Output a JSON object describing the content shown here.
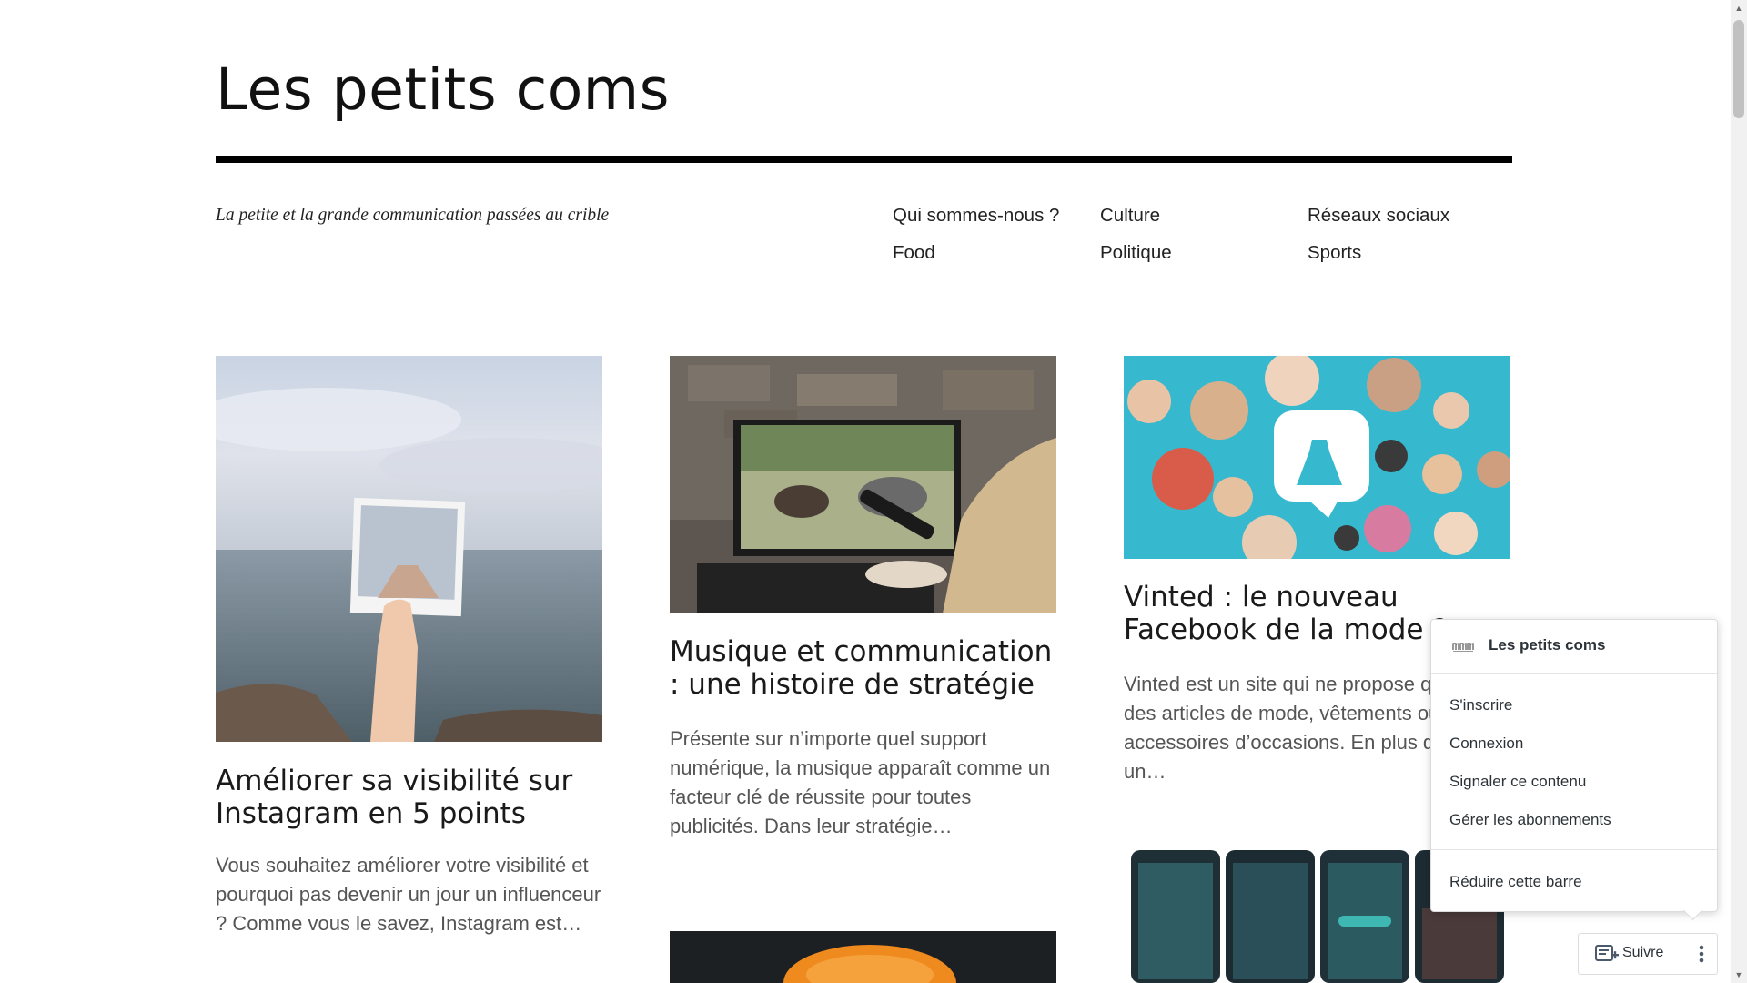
{
  "site": {
    "title": "Les petits coms",
    "tagline": "La petite et la grande communication passées au crible"
  },
  "nav": {
    "items": [
      {
        "label": "Qui sommes-nous ?"
      },
      {
        "label": "Culture"
      },
      {
        "label": "Réseaux sociaux"
      },
      {
        "label": "Food"
      },
      {
        "label": "Politique"
      },
      {
        "label": "Sports"
      }
    ]
  },
  "posts": [
    {
      "title": "Améliorer sa visibilité sur Instagram en 5 points",
      "excerpt": "Vous souhaitez améliorer votre visibilité et pourquoi pas devenir un jour un influenceur ? Comme vous le savez, Instagram est…"
    },
    {
      "title": "Musique et communication : une histoire de stratégie",
      "excerpt": "Présente sur n’importe quel support  numérique, la musique apparaît comme un facteur clé de réussite pour toutes publicités. Dans leur stratégie…"
    },
    {
      "title": "Vinted : le nouveau Facebook de la mode ?",
      "excerpt": "Vinted est un site qui ne propose que des articles de mode, vêtements ou accessoires d’occasions. En plus d’être un…"
    }
  ],
  "follow_popup": {
    "site_name": "Les petits coms",
    "items": [
      {
        "label": "S'inscrire"
      },
      {
        "label": "Connexion"
      },
      {
        "label": "Signaler ce contenu"
      },
      {
        "label": "Gérer les abonnements"
      },
      {
        "label": "Réduire cette barre"
      }
    ],
    "follow_label": "Suivre"
  }
}
